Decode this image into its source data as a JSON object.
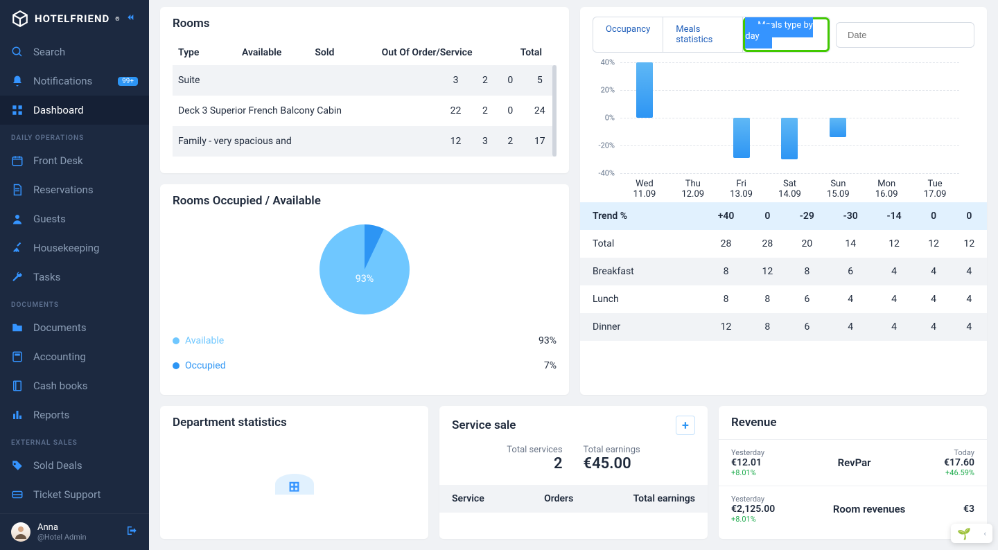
{
  "brand": "HOTELFRIEND",
  "sidebar": {
    "items": [
      {
        "icon": "search",
        "label": "Search"
      },
      {
        "icon": "bell",
        "label": "Notifications",
        "badge": "99+"
      },
      {
        "icon": "grid",
        "label": "Dashboard",
        "active": true
      }
    ],
    "sections": [
      {
        "title": "DAILY OPERATIONS",
        "items": [
          {
            "icon": "calendar",
            "label": "Front Desk"
          },
          {
            "icon": "doc",
            "label": "Reservations"
          },
          {
            "icon": "user",
            "label": "Guests"
          },
          {
            "icon": "broom",
            "label": "Housekeeping"
          },
          {
            "icon": "wrench",
            "label": "Tasks"
          }
        ]
      },
      {
        "title": "DOCUMENTS",
        "items": [
          {
            "icon": "folder",
            "label": "Documents"
          },
          {
            "icon": "accounting",
            "label": "Accounting"
          },
          {
            "icon": "book",
            "label": "Cash books"
          },
          {
            "icon": "chart",
            "label": "Reports"
          }
        ]
      },
      {
        "title": "EXTERNAL SALES",
        "items": [
          {
            "icon": "tag",
            "label": "Sold Deals"
          },
          {
            "icon": "ticket",
            "label": "Ticket Support"
          }
        ]
      }
    ]
  },
  "user": {
    "name": "Anna",
    "role": "@Hotel Admin"
  },
  "rooms": {
    "title": "Rooms",
    "cols": [
      "Type",
      "Available",
      "Sold",
      "Out Of Order/Service",
      "Total"
    ],
    "rows": [
      {
        "type": "Suite",
        "avail": "3",
        "sold": "2",
        "ooo": "0",
        "total": "5"
      },
      {
        "type": "Deck 3 Superior French Balcony Cabin",
        "avail": "22",
        "sold": "2",
        "ooo": "0",
        "total": "24"
      },
      {
        "type": "Family - very spacious and",
        "avail": "12",
        "sold": "3",
        "ooo": "2",
        "total": "17"
      }
    ]
  },
  "occupancy": {
    "title": "Rooms Occupied / Available",
    "center_label": "93%",
    "items": [
      {
        "label": "Available",
        "value": "93%",
        "color": "#6fc7ff"
      },
      {
        "label": "Occupied",
        "value": "7%",
        "color": "#2d95f4"
      }
    ]
  },
  "tabs": [
    "Occupancy",
    "Meals statistics",
    "Meals type by day"
  ],
  "date_placeholder": "Date",
  "chart_data": {
    "type": "bar",
    "categories": [
      "Wed 11.09",
      "Thu 12.09",
      "Fri 13.09",
      "Sat 14.09",
      "Sun 15.09",
      "Mon 16.09",
      "Tue 17.09"
    ],
    "values": [
      40,
      0,
      -29,
      -30,
      -14,
      0,
      0
    ],
    "ylabel": "%",
    "ylim": [
      -40,
      40
    ],
    "yticks": [
      "40%",
      "20%",
      "0%",
      "-20%",
      "-40%"
    ]
  },
  "meals": {
    "label_trend": "Trend %",
    "rows": [
      {
        "label": "Trend %",
        "v": [
          "+40",
          "0",
          "-29",
          "-30",
          "-14",
          "0",
          "0"
        ],
        "cls": "trend"
      },
      {
        "label": "Total",
        "v": [
          "28",
          "28",
          "20",
          "14",
          "12",
          "12",
          "12"
        ]
      },
      {
        "label": "Breakfast",
        "v": [
          "8",
          "12",
          "8",
          "6",
          "4",
          "4",
          "4"
        ]
      },
      {
        "label": "Lunch",
        "v": [
          "8",
          "8",
          "6",
          "4",
          "4",
          "4",
          "4"
        ]
      },
      {
        "label": "Dinner",
        "v": [
          "12",
          "8",
          "6",
          "4",
          "4",
          "4",
          "4"
        ]
      }
    ]
  },
  "dept": {
    "title": "Department statistics"
  },
  "service": {
    "title": "Service sale",
    "total_services_label": "Total services",
    "total_services": "2",
    "total_earnings_label": "Total earnings",
    "total_earnings": "€45.00",
    "hdr": [
      "Service",
      "Orders",
      "Total earnings"
    ]
  },
  "revenue": {
    "title": "Revenue",
    "rows": [
      {
        "yest_label": "Yesterday",
        "yest": "€12.01",
        "yd": "+8.01%",
        "mid": "RevPar",
        "today_label": "Today",
        "today": "€17.60",
        "td": "+46.59%"
      },
      {
        "yest_label": "Yesterday",
        "yest": "€2,125.00",
        "yd": "+8.01%",
        "mid": "Room revenues",
        "today_label": "",
        "today": "€3",
        "td": ""
      }
    ]
  }
}
